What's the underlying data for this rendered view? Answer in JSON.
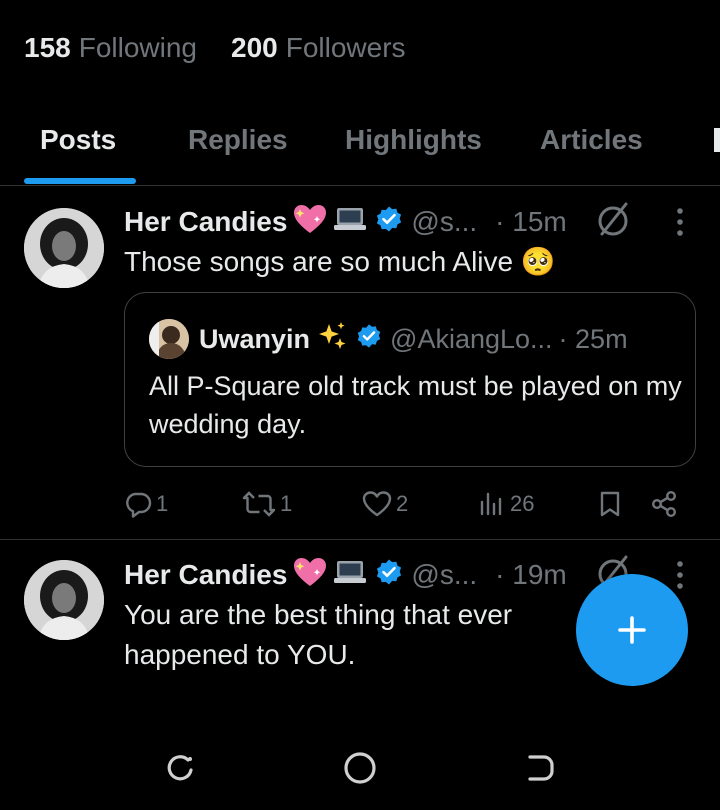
{
  "profile": {
    "following_count": "158",
    "following_label": "Following",
    "followers_count": "200",
    "followers_label": "Followers"
  },
  "tabs": [
    {
      "label": "Posts",
      "active": true
    },
    {
      "label": "Replies",
      "active": false
    },
    {
      "label": "Highlights",
      "active": false
    },
    {
      "label": "Articles",
      "active": false
    }
  ],
  "posts": [
    {
      "author_name": "Her Candies",
      "author_emojis": [
        "sparkling-heart-icon",
        "laptop-icon"
      ],
      "verified": true,
      "handle": "@s...",
      "time": "· 15m",
      "text": "Those songs are so much Alive 🥺",
      "quote": {
        "author_name": "Uwanyin",
        "author_emoji": "sparkles-icon",
        "verified": true,
        "handle": "@AkiangLo...",
        "time": "· 25m",
        "text": "All P-Square old track must be played on my wedding day."
      },
      "stats": {
        "replies": "1",
        "reposts": "1",
        "likes": "2",
        "views": "26"
      }
    },
    {
      "author_name": "Her Candies",
      "author_emojis": [
        "sparkling-heart-icon",
        "laptop-icon"
      ],
      "verified": true,
      "handle": "@s...",
      "time": "· 19m",
      "text": "You are the best thing that ever happened to YOU."
    }
  ],
  "colors": {
    "background": "#000000",
    "accent": "#1d9bf0",
    "text_primary": "#e7e9ea",
    "text_secondary": "#71767b",
    "divider": "#2f3336"
  },
  "fab_icon": "plus-icon",
  "navbar_icons": [
    "recent-apps-icon",
    "home-icon",
    "back-icon"
  ]
}
